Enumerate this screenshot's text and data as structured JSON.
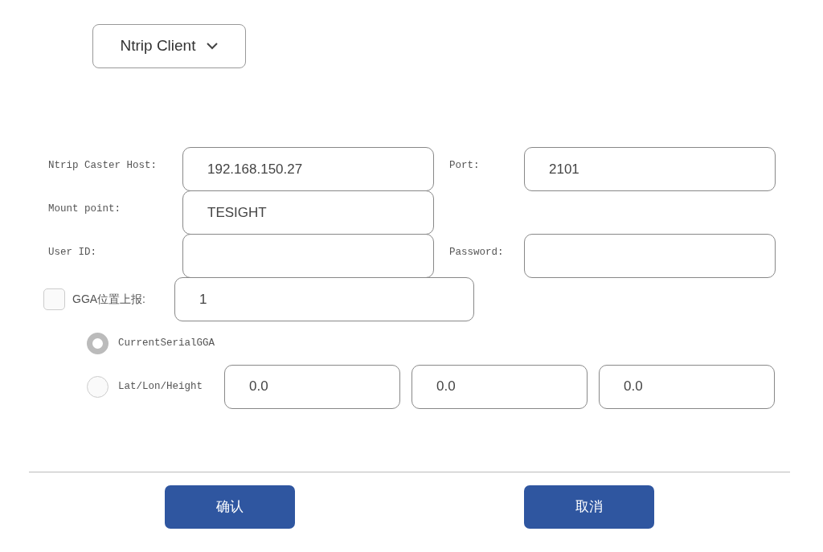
{
  "mode_select": {
    "value": "Ntrip Client"
  },
  "rows": [
    [
      {
        "label": "Ntrip Caster Host:",
        "value": "192.168.150.27"
      },
      {
        "label": "Port:",
        "value": "2101"
      }
    ],
    [
      {
        "label": "Mount point:",
        "value": "TESIGHT"
      }
    ],
    [
      {
        "label": "User ID:"
      },
      {
        "label": "Password:"
      }
    ]
  ],
  "gga": {
    "checked": false,
    "label": "GGA位置上报:",
    "value": "1"
  },
  "radios": [
    {
      "label": "CurrentSerialGGA",
      "selected": true
    },
    {
      "label": "Lat/Lon/Height",
      "selected": false,
      "values": [
        "0.0",
        "0.0",
        "0.0"
      ]
    }
  ],
  "buttons": [
    "确认",
    "取消"
  ]
}
